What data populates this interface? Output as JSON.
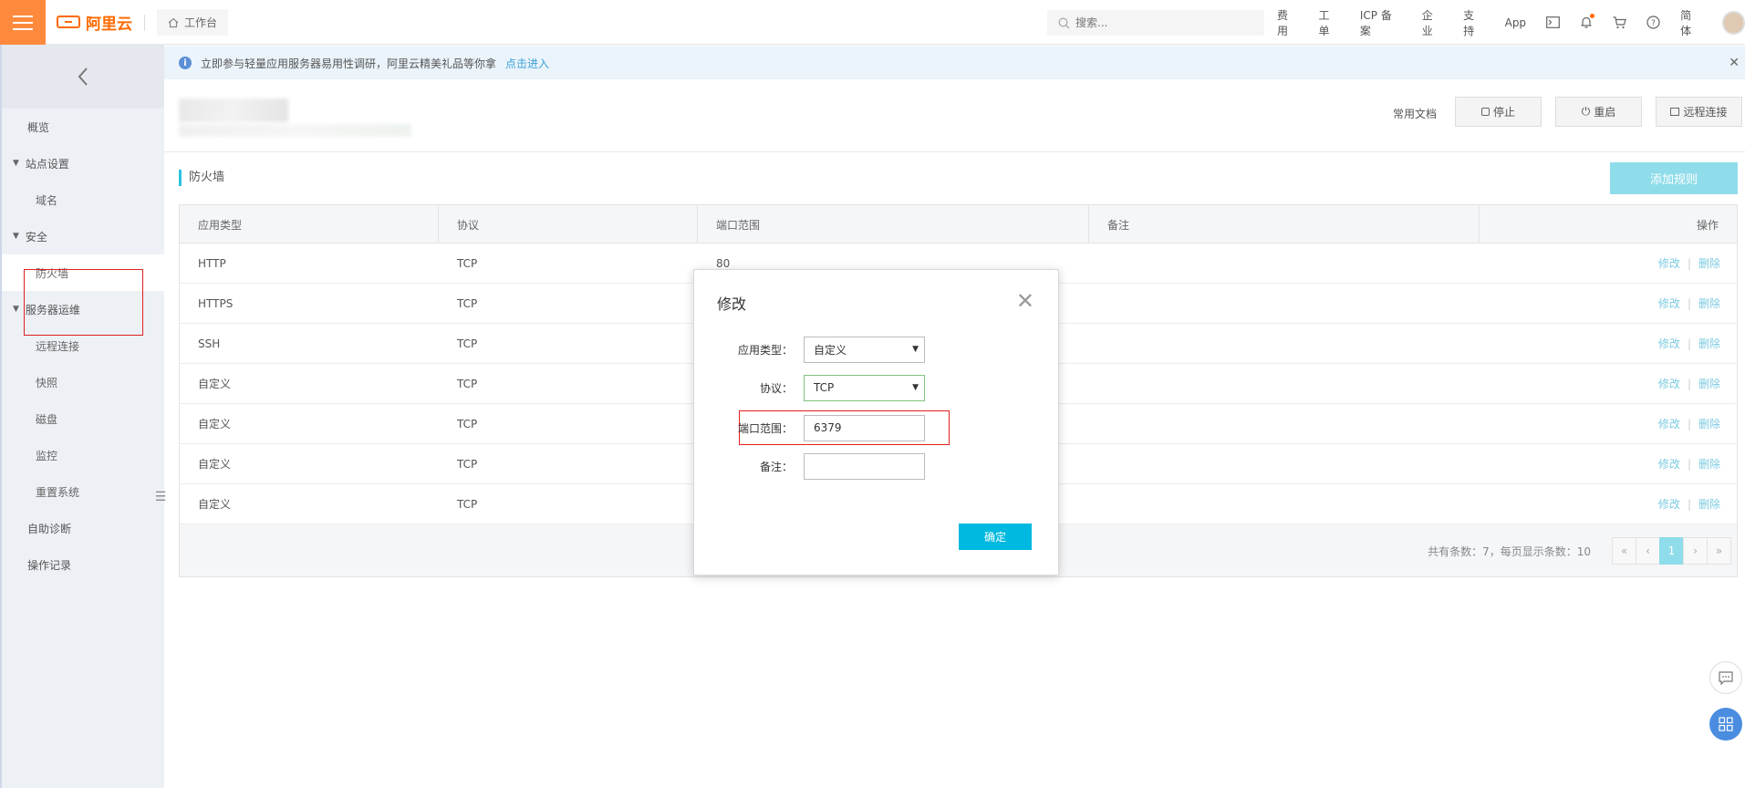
{
  "topbar": {
    "brand": "阿里云",
    "workbench": "工作台",
    "search_placeholder": "搜索...",
    "nav": [
      "费用",
      "工单",
      "ICP 备案",
      "企业",
      "支持",
      "App"
    ],
    "lang": "简体"
  },
  "sidebar": {
    "overview": "概览",
    "site_settings": "站点设置",
    "domain": "域名",
    "security": "安全",
    "firewall": "防火墙",
    "server_ops": "服务器运维",
    "remote": "远程连接",
    "snapshot": "快照",
    "disk": "磁盘",
    "monitor": "监控",
    "reset": "重置系统",
    "diagnosis": "自助诊断",
    "oplog": "操作记录"
  },
  "notice": {
    "text": "立即参与轻量应用服务器易用性调研，阿里云精美礼品等你拿",
    "link": "点击进入"
  },
  "header": {
    "docs": "常用文档",
    "stop": "停止",
    "restart": "重启",
    "remote": "远程连接"
  },
  "firewall": {
    "title": "防火墙",
    "add_button": "添加规则",
    "columns": [
      "应用类型",
      "协议",
      "端口范围",
      "备注",
      "操作"
    ],
    "rows": [
      {
        "type": "HTTP",
        "protocol": "TCP",
        "port": "80",
        "note": ""
      },
      {
        "type": "HTTPS",
        "protocol": "TCP",
        "port": "",
        "note": ""
      },
      {
        "type": "SSH",
        "protocol": "TCP",
        "port": "",
        "note": ""
      },
      {
        "type": "自定义",
        "protocol": "TCP",
        "port": "",
        "note": ""
      },
      {
        "type": "自定义",
        "protocol": "TCP",
        "port": "",
        "note": ""
      },
      {
        "type": "自定义",
        "protocol": "TCP",
        "port": "",
        "note": ""
      },
      {
        "type": "自定义",
        "protocol": "TCP",
        "port": "",
        "note": ""
      }
    ],
    "edit": "修改",
    "delete": "删除",
    "total": "共有条数：7，每页显示条数：10",
    "pager": [
      "«",
      "‹",
      "1",
      "›",
      "»"
    ]
  },
  "modal": {
    "title": "修改",
    "app_type_label": "应用类型：",
    "app_type_value": "自定义",
    "protocol_label": "协议：",
    "protocol_value": "TCP",
    "port_label": "端口范围：",
    "port_value": "6379",
    "note_label": "备注：",
    "note_value": "",
    "ok": "确定"
  }
}
